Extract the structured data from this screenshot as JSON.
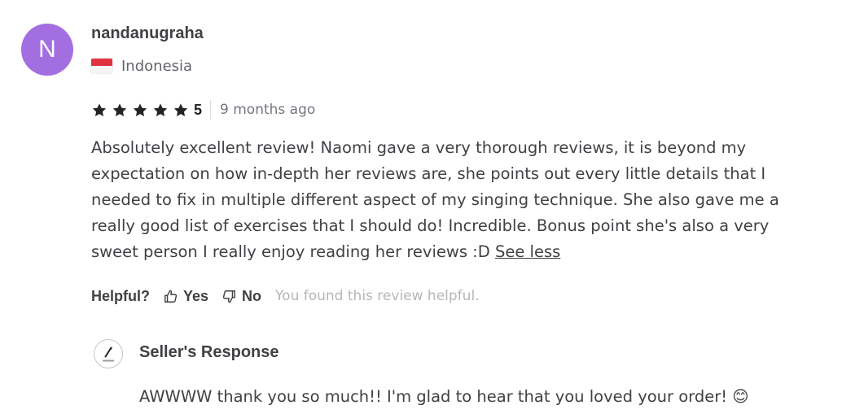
{
  "reviewer": {
    "avatar_initial": "N",
    "avatar_color": "#a26ee0",
    "username": "nandanugraha",
    "country": "Indonesia",
    "country_flag_icon": "indonesia-flag-icon"
  },
  "rating": {
    "stars_filled": 5,
    "stars_total": 5,
    "value": "5",
    "time_ago": "9 months ago"
  },
  "review": {
    "text": "Absolutely excellent review! Naomi gave a very thorough reviews, it is beyond my expectation on how in-depth her reviews are, she points out every little details that I needed to fix in multiple different aspect of my singing technique. She also gave me a really good list of exercises that I should do! Incredible. Bonus point she's also a very sweet person I really enjoy reading her reviews :D",
    "toggle_label": "See less"
  },
  "helpful": {
    "label": "Helpful?",
    "yes_label": "Yes",
    "no_label": "No",
    "note": "You found this review helpful."
  },
  "seller_response": {
    "title": "Seller's Response",
    "logo_icon": "seller-logo-icon",
    "text": "AWWWW thank you so much!! I'm glad to hear that you loved your order! 😊"
  },
  "colors": {
    "text_primary": "#404145",
    "text_muted": "#74767e",
    "text_faint": "#b5b6ba",
    "star": "#222325",
    "flag_red": "#e0323f"
  }
}
